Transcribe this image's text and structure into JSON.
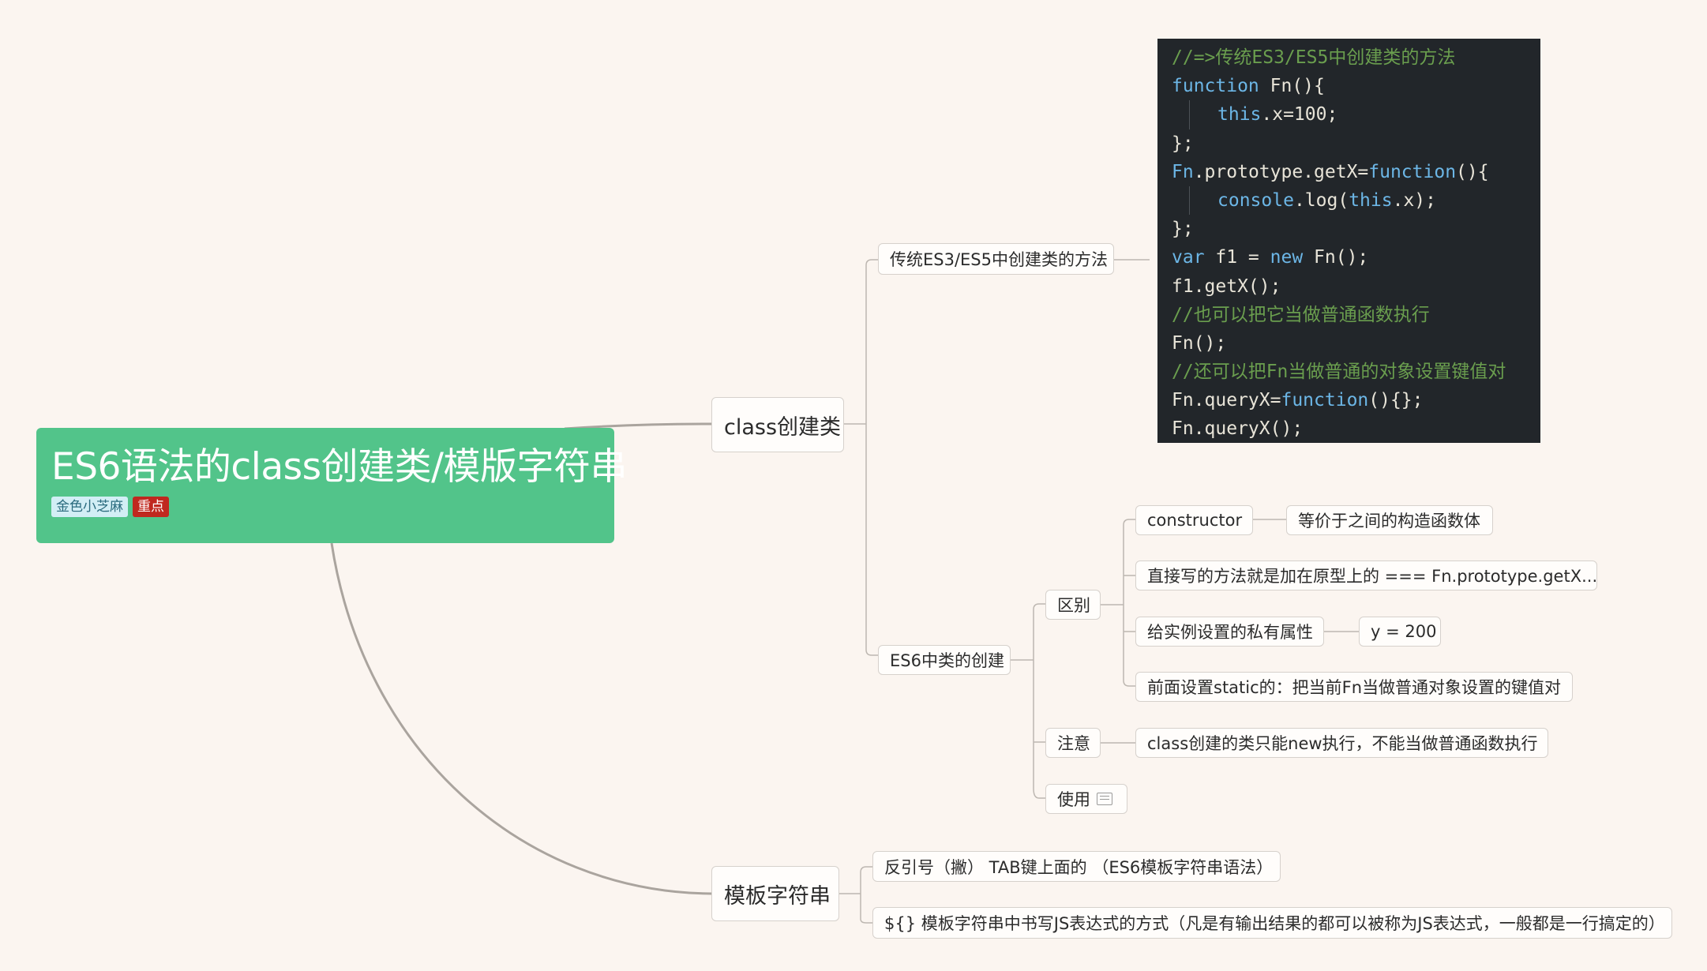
{
  "root": {
    "title": "ES6语法的class创建类/模版字符串",
    "tags": [
      "金色小芝麻",
      "重点"
    ]
  },
  "class_branch": {
    "label": "class创建类",
    "traditional": {
      "label": "传统ES3/ES5中创建类的方法",
      "code": [
        "//=>传统ES3/ES5中创建类的方法",
        "function Fn(){",
        "this.x=100;",
        "};",
        "Fn.prototype.getX=function(){",
        "console.log(this.x);",
        "};",
        "var f1 = new Fn();",
        "f1.getX();",
        "//也可以把它当做普通函数执行",
        "Fn();",
        "//还可以把Fn当做普通的对象设置键值对",
        "Fn.queryX=function(){};",
        "Fn.queryX();"
      ]
    },
    "es6": {
      "label": "ES6中类的创建",
      "diff": {
        "label": "区别",
        "constructor": "constructor",
        "constructor_desc": "等价于之间的构造函数体",
        "direct_methods": "直接写的方法就是加在原型上的 === Fn.prototype.getX...",
        "private_prop": "给实例设置的私有属性",
        "private_prop_example": "y = 200",
        "static": "前面设置static的：把当前Fn当做普通对象设置的键值对"
      },
      "note": {
        "label": "注意",
        "text": "class创建的类只能new执行，不能当做普通函数执行"
      },
      "usage": {
        "label": "使用"
      }
    }
  },
  "template_branch": {
    "label": "模板字符串",
    "items": [
      "反引号（撇） TAB键上面的 （ES6模板字符串语法）",
      "${} 模板字符串中书写JS表达式的方式（凡是有输出结果的都可以被称为JS表达式，一般都是一行搞定的）"
    ]
  },
  "colors": {
    "root": "#52c48a",
    "code_bg": "#22262a",
    "background": "#fbf5f0"
  }
}
